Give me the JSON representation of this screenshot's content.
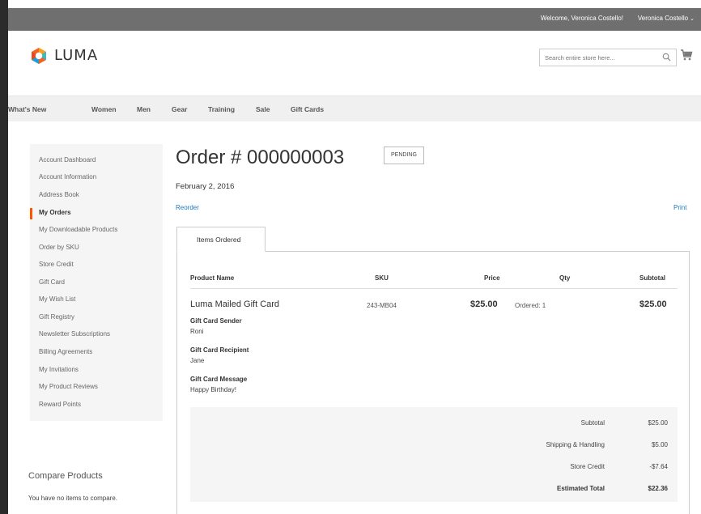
{
  "topbar": {
    "welcome": "Welcome, Veronica Costello!",
    "account_name": "Veronica Costello",
    "account_chevron": "⌄"
  },
  "header": {
    "logo_text": "LUMA",
    "search_placeholder": "Search entire store here...",
    "icons": [
      "luma-logo-icon",
      "search-icon",
      "cart-icon"
    ]
  },
  "nav": {
    "items": [
      "What's New",
      "Women",
      "Men",
      "Gear",
      "Training",
      "Sale",
      "Gift Cards"
    ]
  },
  "sidebar": {
    "items": [
      "Account Dashboard",
      "Account Information",
      "Address Book",
      "My Orders",
      "My Downloadable Products",
      "Order by SKU",
      "Store Credit",
      "Gift Card",
      "My Wish List",
      "Gift Registry",
      "Newsletter Subscriptions",
      "Billing Agreements",
      "My Invitations",
      "My Product Reviews",
      "Reward Points"
    ],
    "active_item": "My Orders",
    "accent_color": "#ff5501"
  },
  "compare": {
    "title": "Compare Products",
    "text": "You have no items to compare."
  },
  "order": {
    "title": "Order # 000000003",
    "status": "PENDING",
    "date": "February 2, 2016",
    "reorder": "Reorder",
    "print": "Print",
    "tab": "Items Ordered",
    "columns": [
      "Product Name",
      "SKU",
      "Price",
      "Qty",
      "Subtotal"
    ],
    "item": {
      "name": "Luma Mailed Gift Card",
      "sku": "243-MB04",
      "price": "$25.00",
      "qty": "Ordered: 1",
      "subtotal": "$25.00",
      "options": [
        {
          "label": "Gift Card Sender",
          "value": "Roni"
        },
        {
          "label": "Gift Card Recipient",
          "value": "Jane"
        },
        {
          "label": "Gift Card Message",
          "value": "Happy Birthday!"
        }
      ]
    },
    "totals": [
      {
        "label": "Subtotal",
        "value": "$25.00"
      },
      {
        "label": "Shipping & Handling",
        "value": "$5.00"
      },
      {
        "label": "Store Credit",
        "value": "-$7.64"
      },
      {
        "label": "Estimated Total",
        "value": "$22.36"
      }
    ],
    "link_color": "#1979c3"
  }
}
